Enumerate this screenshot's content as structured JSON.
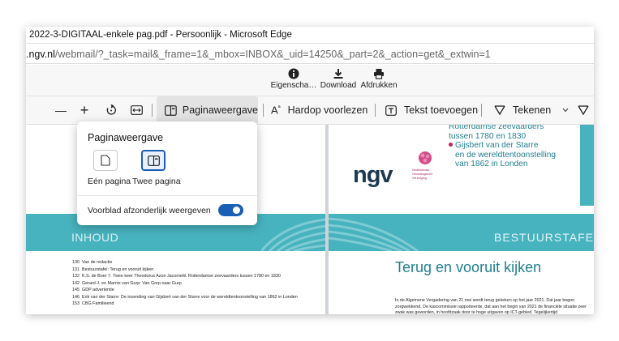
{
  "window": {
    "title": "2022-3-DIGITAAL-enkele pag.pdf - Persoonlijk - Microsoft Edge"
  },
  "address": {
    "host": ".ngv.nl",
    "path": "/webmail/?_task=mail&_frame=1&_mbox=INBOX&_uid=14250&_part=2&_action=get&_extwin=1"
  },
  "pdf_actions": {
    "properties": "Eigenscha…",
    "download": "Download",
    "print": "Afdrukken"
  },
  "viewer_toolbar": {
    "zoom_out": "—",
    "zoom_in": "+",
    "page_view": "Paginaweergave",
    "read_aloud": "Hardop voorlezen",
    "add_text": "Tekst toevoegen",
    "draw": "Tekenen"
  },
  "popup": {
    "title": "Paginaweergave",
    "single": "Eén pagina",
    "two": "Twee pagina",
    "cover_toggle": "Voorblad afzonderlijk weergeven",
    "cover_toggle_on": true
  },
  "document": {
    "left_section": "INHOUD",
    "right_section": "BESTUURSTAFE",
    "toc": [
      {
        "num": "130",
        "text": "Van de redactie"
      },
      {
        "num": "131",
        "text": "Bestuurstafel: Terug en vooruit kijken"
      },
      {
        "num": "132",
        "text": "K.S. de Boer †: Twee keer Theodorus Azon Jacometti. Rotterdamse zeevaarders tussen 1780 en 1830"
      },
      {
        "num": "142",
        "text": "Gerard J. en Marnix van Gurp: Van Gorp naar Gurp"
      },
      {
        "num": "145",
        "text": "GDP advertentie"
      },
      {
        "num": "146",
        "text": "Erik van der Starre: De inzending van Gijsbert van der Starre voor de wereldtentoonstelling van 1862 in Londen"
      },
      {
        "num": "153",
        "text": "CBG Familieend"
      }
    ],
    "ngv_items": [
      {
        "bullet": false,
        "text": "Rotterdamse zeevaarders"
      },
      {
        "bullet": false,
        "text": "tussen 1780 en 1830"
      },
      {
        "bullet": true,
        "text": "Gijsbert van der Starre"
      },
      {
        "bullet": false,
        "text": "en de wereldtentoonstelling"
      },
      {
        "bullet": false,
        "text": "van 1862 in Londen"
      }
    ],
    "ngv_logo": "ngv",
    "ngv_sub": [
      "Nederlandse",
      "Genealogische",
      "Vereniging"
    ],
    "heading": "Terug en vooruit kijken",
    "paragraph": "In de Algemene Vergadering van 21 mei wordt terug gekeken op het jaar 2021. Dat jaar begon zorgwekkend. De kascommissie rapporteerde, dat aan het begin van 2021 de financiële situatie zeer zwak was geworden, in hoofdzaak door te hoge uitgaven op ICT-gebied. Tegelijkertijd"
  },
  "colors": {
    "teal": "#47b3bf",
    "accent": "#1a5fb4",
    "heading": "#20808f"
  }
}
